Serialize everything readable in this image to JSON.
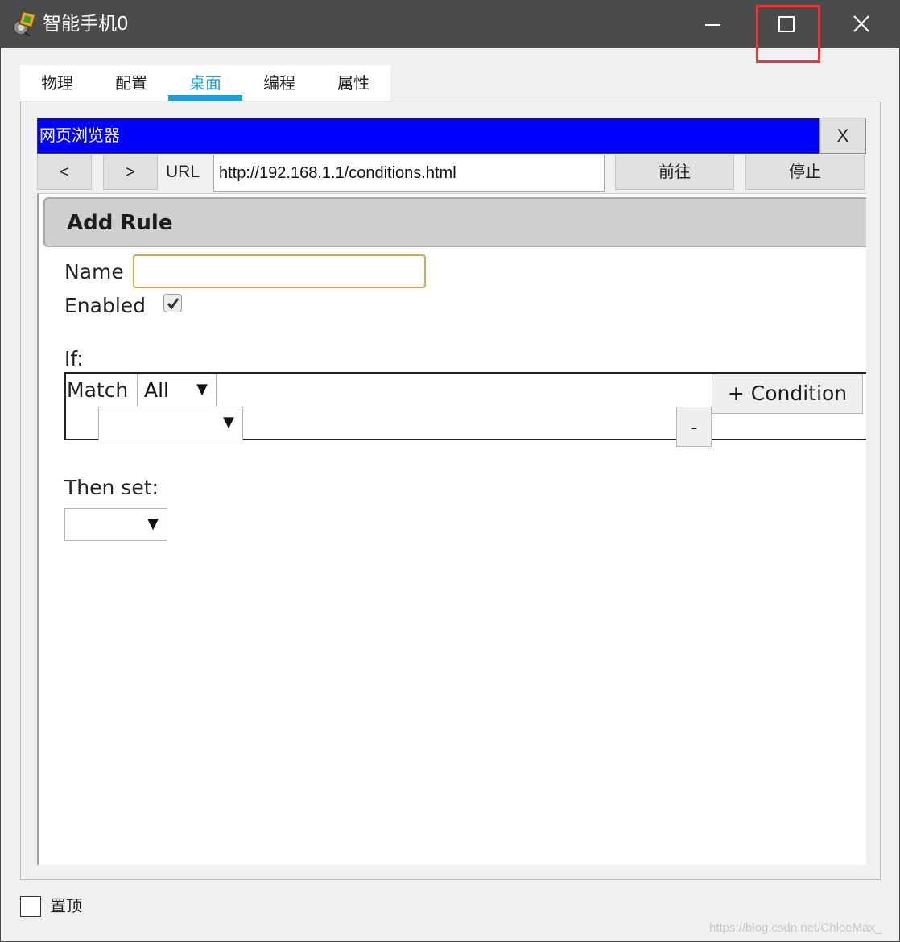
{
  "window": {
    "title": "智能手机0",
    "controls": [
      "minimize",
      "maximize",
      "close"
    ]
  },
  "tabs": [
    {
      "label": "物理",
      "active": false
    },
    {
      "label": "配置",
      "active": false
    },
    {
      "label": "桌面",
      "active": true
    },
    {
      "label": "编程",
      "active": false
    },
    {
      "label": "属性",
      "active": false
    }
  ],
  "browser": {
    "title": "网页浏览器",
    "close_label": "X",
    "back_label": "<",
    "forward_label": ">",
    "url_label": "URL",
    "url_value": "http://192.168.1.1/conditions.html",
    "go_label": "前往",
    "stop_label": "停止"
  },
  "page": {
    "header": "Add Rule",
    "name_label": "Name",
    "name_value": "",
    "enabled_label": "Enabled",
    "enabled_checked": true,
    "if_label": "If:",
    "match_label": "Match",
    "match_value": "All",
    "condition_value": "",
    "add_condition_label": "+ Condition",
    "remove_condition_label": "-",
    "then_label": "Then set:",
    "then_value": ""
  },
  "footer": {
    "pin_label": "置顶",
    "pin_checked": false
  },
  "watermark": "https://blog.csdn.net/ChloeMax_",
  "colors": {
    "titlebar": "#4b4b4b",
    "active_tab": "#1a9fd6",
    "browser_titlebar": "#0000ff",
    "highlight": "#e8383d",
    "name_input_border": "#d4a64a"
  },
  "icons": {
    "app": "packet-tracer-device-icon",
    "minimize": "minimize-icon",
    "maximize": "maximize-icon",
    "close": "close-icon",
    "checkmark": "checkmark-icon",
    "dropdown": "dropdown-arrow-icon"
  }
}
